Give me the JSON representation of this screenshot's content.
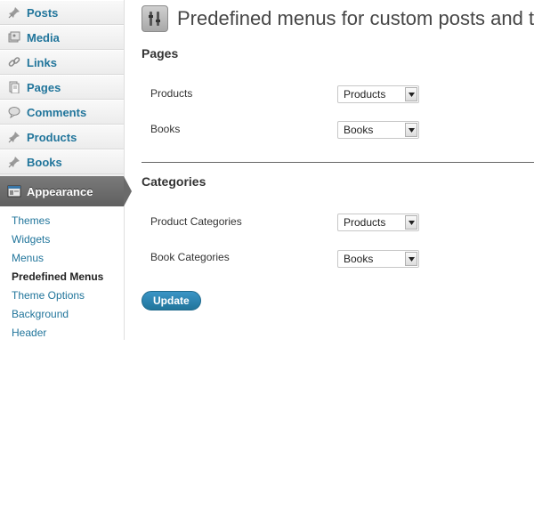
{
  "sidebar": {
    "items": [
      {
        "label": "Posts",
        "icon": "pin-icon"
      },
      {
        "label": "Media",
        "icon": "media-icon"
      },
      {
        "label": "Links",
        "icon": "link-icon"
      },
      {
        "label": "Pages",
        "icon": "pages-icon"
      },
      {
        "label": "Comments",
        "icon": "comment-icon"
      },
      {
        "label": "Products",
        "icon": "pin-icon"
      },
      {
        "label": "Books",
        "icon": "pin-icon"
      }
    ],
    "active": {
      "label": "Appearance",
      "icon": "appearance-icon"
    },
    "submenu": [
      {
        "label": "Themes"
      },
      {
        "label": "Widgets"
      },
      {
        "label": "Menus"
      },
      {
        "label": "Predefined Menus",
        "current": true
      },
      {
        "label": "Theme Options"
      },
      {
        "label": "Background"
      },
      {
        "label": "Header"
      }
    ]
  },
  "main": {
    "title": "Predefined menus for custom posts and t",
    "title_icon": "tools-icon",
    "sections": [
      {
        "heading": "Pages",
        "rows": [
          {
            "label": "Products",
            "selected": "Products"
          },
          {
            "label": "Books",
            "selected": "Books"
          }
        ]
      },
      {
        "heading": "Categories",
        "rows": [
          {
            "label": "Product Categories",
            "selected": "Products"
          },
          {
            "label": "Book Categories",
            "selected": "Books"
          }
        ]
      }
    ],
    "update_label": "Update"
  },
  "colors": {
    "link": "#21759b",
    "active_bg": "#6a6a6a",
    "button": "#21759b"
  }
}
